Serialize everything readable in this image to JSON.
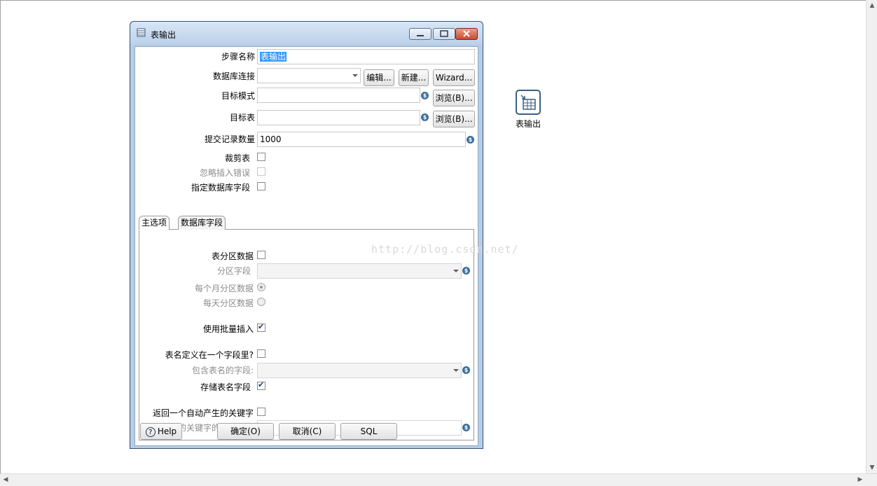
{
  "dialog": {
    "title": "表输出",
    "step_name_label": "步骤名称",
    "step_name_value": "表输出",
    "connection_label": "数据库连接",
    "connection_value": "",
    "edit_button": "编辑...",
    "new_button": "新建...",
    "wizard_button": "Wizard...",
    "schema_label": "目标模式",
    "schema_value": "",
    "browse_button": "浏览(B)...",
    "table_label": "目标表",
    "table_value": "",
    "commit_label": "提交记录数量",
    "commit_value": "1000",
    "truncate_label": "裁剪表",
    "truncate_checked": false,
    "ignore_errors_label": "忽略插入错误",
    "ignore_errors_checked": false,
    "specify_fields_label": "指定数据库字段",
    "specify_fields_checked": false,
    "tabs": [
      "主选项",
      "数据库字段"
    ],
    "main_tab": {
      "partition_label": "表分区数据",
      "partition_checked": false,
      "partition_field_label": "分区字段",
      "partition_field_value": "",
      "monthly_label": "每个月分区数据",
      "daily_label": "每天分区数据",
      "batch_label": "使用批量插入",
      "batch_checked": true,
      "table_in_field_label": "表名定义在一个字段里?",
      "table_in_field_checked": false,
      "table_name_field_label": "包含表名的字段:",
      "table_name_field_value": "",
      "store_table_name_label": "存储表名字段",
      "store_table_name_checked": true,
      "return_key_label": "返回一个自动产生的关键字",
      "return_key_checked": false,
      "key_field_label": "自动产生的关键字的字段名称",
      "key_field_value": ""
    },
    "help_button": "Help",
    "ok_button": "确定(O)",
    "cancel_button": "取消(C)",
    "sql_button": "SQL"
  },
  "watermark": "http://blog.csdn.net/",
  "canvas_step": {
    "label": "表输出",
    "icon": "table-output-icon"
  },
  "colors": {
    "accent": "#3c6e9e",
    "selection": "#3399ff",
    "frame": "#b7cde6"
  }
}
